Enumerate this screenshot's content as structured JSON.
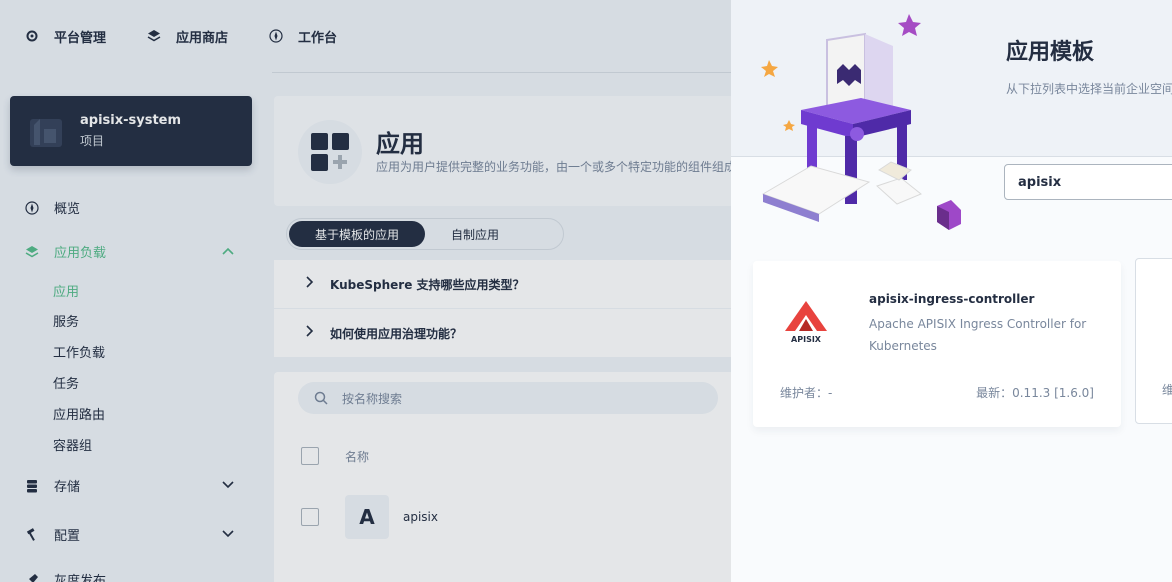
{
  "topnav": {
    "items": [
      {
        "label": "平台管理",
        "icon": "gear-icon"
      },
      {
        "label": "应用商店",
        "icon": "layers-icon"
      },
      {
        "label": "工作台",
        "icon": "compass-icon"
      }
    ]
  },
  "project": {
    "name": "apisix-system",
    "type": "项目"
  },
  "sidebar": {
    "overview": "概览",
    "workloads": "应用负载",
    "workload_subs": [
      "应用",
      "服务",
      "工作负载",
      "任务",
      "应用路由",
      "容器组"
    ],
    "storage": "存储",
    "config": "配置",
    "gray": "灰度发布"
  },
  "main": {
    "title": "应用",
    "desc": "应用为用户提供完整的业务功能，由一个或多个特定功能的组件组成。",
    "tabs": [
      "基于模板的应用",
      "自制应用"
    ],
    "faq": [
      "KubeSphere 支持哪些应用类型？",
      "如何使用应用治理功能？"
    ],
    "search_placeholder": "按名称搜索",
    "table_header_name": "名称",
    "rows": [
      {
        "avatar": "A",
        "name": "apisix"
      }
    ]
  },
  "drawer": {
    "title": "应用模板",
    "desc": "从下拉列表中选择当前企业空间",
    "search_value": "apisix",
    "card": {
      "name": "apisix-ingress-controller",
      "desc": "Apache APISIX Ingress Controller for Kubernetes",
      "maintainer": "维护者：-",
      "latest": "最新：0.11.3 [1.6.0]",
      "logo_text": "APISIX"
    },
    "card2_maint": "维护"
  },
  "colors": {
    "accent": "#55bc8a",
    "dark": "#242e42",
    "apisix_red": "#e8433e"
  }
}
